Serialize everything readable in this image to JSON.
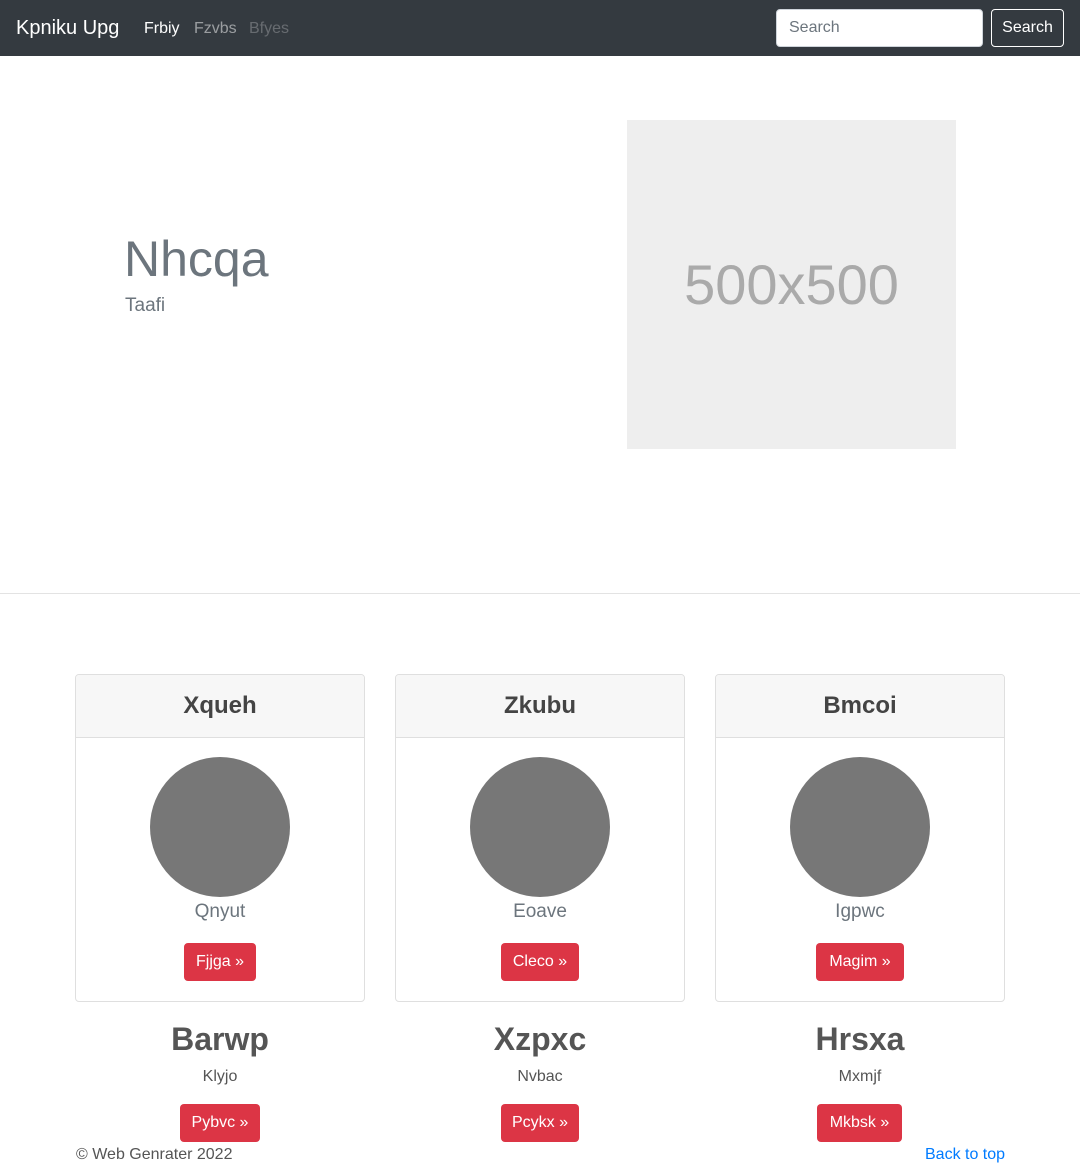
{
  "navbar": {
    "brand": "Kpniku Upg",
    "links": [
      "Frbiy",
      "Fzvbs",
      "Bfyes"
    ],
    "search_placeholder": "Search",
    "search_button": "Search"
  },
  "hero": {
    "title": "Nhcqa",
    "subtitle": "Taafi",
    "image_label": "500x500"
  },
  "cards": [
    {
      "header": "Xqueh",
      "name": "Qnyut",
      "button": "Fjjga »"
    },
    {
      "header": "Zkubu",
      "name": "Eoave",
      "button": "Cleco »"
    },
    {
      "header": "Bmcoi",
      "name": "Igpwc",
      "button": "Magim »"
    }
  ],
  "columns": [
    {
      "title": "Barwp",
      "text": "Klyjo",
      "button": "Pybvc »"
    },
    {
      "title": "Xzpxc",
      "text": "Nvbac",
      "button": "Pcykx »"
    },
    {
      "title": "Hrsxa",
      "text": "Mxmjf",
      "button": "Mkbsk »"
    }
  ],
  "footer": {
    "copyright": "© Web Genrater 2022",
    "back_to_top": "Back to top"
  },
  "colors": {
    "navbar": "#343a40",
    "danger": "#dc3545",
    "link": "#007bff"
  }
}
